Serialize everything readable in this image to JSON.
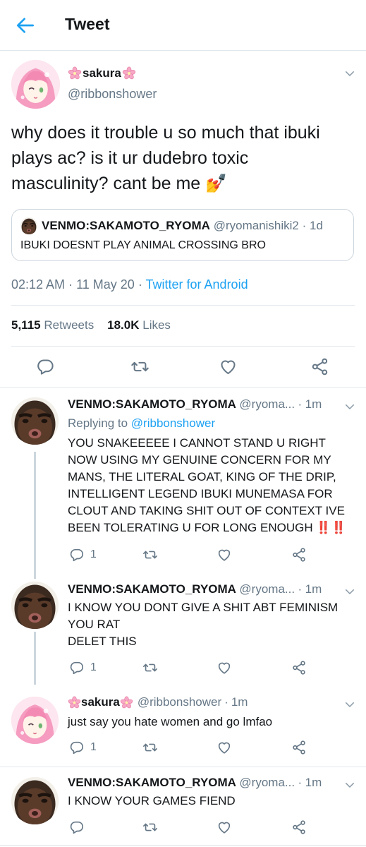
{
  "header": {
    "title": "Tweet"
  },
  "main_tweet": {
    "display_name": "sakura",
    "handle": "@ribbonshower",
    "text": "why does it trouble u so much that ibuki plays ac? is it ur dudebro toxic masculinity? cant be me",
    "emoji": "💅",
    "quoted": {
      "name": "VENMO:SAKAMOTO_RYOMA",
      "handle": "@ryomanishiki2",
      "sep": "·",
      "time": "1d",
      "text": "IBUKI DOESNT PLAY ANIMAL CROSSING BRO"
    },
    "time": "02:12 AM",
    "date": "11 May 20",
    "dot": "·",
    "source": "Twitter for Android",
    "retweets_count": "5,115",
    "retweets_label": "Retweets",
    "likes_count": "18.0K",
    "likes_label": "Likes"
  },
  "replies": [
    {
      "name": "VENMO:SAKAMOTO_RYOMA",
      "handle": "@ryoma...",
      "sep": "·",
      "time": "1m",
      "replying_label": "Replying to",
      "replying_handle": "@ribbonshower",
      "text": "YOU SNAKEEEEE I CANNOT STAND U RIGHT\nNOW USING MY GENUINE CONCERN FOR MY\nMANS, THE LITERAL GOAT, KING OF THE DRIP,\nINTELLIGENT LEGEND IBUKI MUNEMASA FOR\nCLOUT AND TAKING SHIT OUT OF CONTEXT IVE\nBEEN TOLERATING U FOR LONG ENOUGH",
      "emoji": "‼️‼️",
      "reply_count": "1"
    },
    {
      "name": "VENMO:SAKAMOTO_RYOMA",
      "handle": "@ryoma...",
      "sep": "·",
      "time": "1m",
      "text": "I KNOW YOU DONT GIVE A SHIT ABT FEMINISM\nYOU RAT\nDELET THIS",
      "reply_count": "1"
    },
    {
      "name": "sakura",
      "handle": "@ribbonshower",
      "sep": "·",
      "time": "1m",
      "text": "just say you hate women and go lmfao",
      "reply_count": "1"
    },
    {
      "name": "VENMO:SAKAMOTO_RYOMA",
      "handle": "@ryoma...",
      "sep": "·",
      "time": "1m",
      "text": "I KNOW YOUR GAMES FIEND",
      "reply_count": ""
    }
  ],
  "colors": {
    "accent": "#1da1f2",
    "grey": "#657786",
    "divider": "#e1e8ed"
  },
  "icons": [
    "back-arrow-icon",
    "chevron-down-icon",
    "reply-icon",
    "retweet-icon",
    "like-icon",
    "share-icon",
    "sakura-flower-icon"
  ]
}
